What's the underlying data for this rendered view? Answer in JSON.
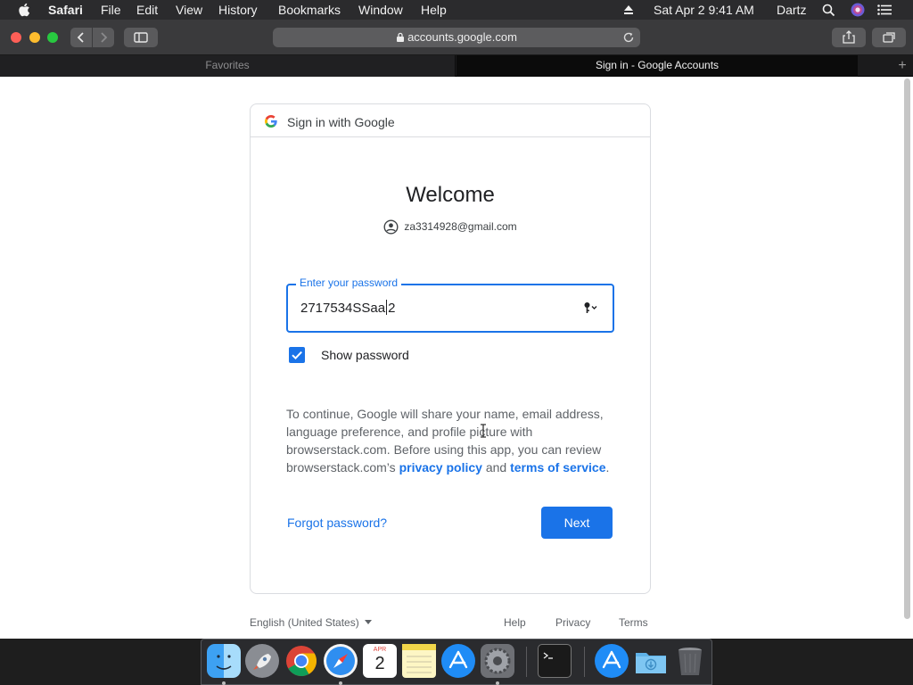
{
  "menubar": {
    "app_name": "Safari",
    "menus": [
      "File",
      "Edit",
      "View",
      "History",
      "Bookmarks",
      "Window",
      "Help"
    ],
    "datetime": "Sat Apr 2  9:41 AM",
    "user": "Dartz",
    "icons": [
      "apple-icon",
      "eject-icon",
      "search-icon",
      "siri-icon",
      "notification-center-icon"
    ]
  },
  "toolbar": {
    "url": "accounts.google.com",
    "icons": [
      "back-icon",
      "forward-icon",
      "sidebar-icon",
      "lock-icon",
      "reload-icon",
      "share-icon",
      "tabs-overview-icon"
    ]
  },
  "tabs": [
    {
      "label": "Favorites",
      "active": false
    },
    {
      "label": "Sign in - Google Accounts",
      "active": true
    }
  ],
  "new_tab_label": "+",
  "signin": {
    "header_title": "Sign in with Google",
    "welcome": "Welcome",
    "email": "za3314928@gmail.com",
    "password_label": "Enter your password",
    "password_before_caret": "2717534SSaa",
    "password_after_caret": "2",
    "show_password_label": "Show password",
    "show_password_checked": true,
    "disclaimer_text": "To continue, Google will share your name, email address, language preference, and profile picture with browserstack.com. Before using this app, you can review browserstack.com’s ",
    "privacy_link": "privacy policy",
    "and_text": " and ",
    "terms_link": "terms of service",
    "period": ".",
    "forgot_label": "Forgot password?",
    "next_label": "Next"
  },
  "footer": {
    "language": "English (United States)",
    "help": "Help",
    "privacy": "Privacy",
    "terms": "Terms"
  },
  "dock": {
    "apps": [
      "Finder",
      "Launchpad",
      "Chrome",
      "Safari",
      "Calendar",
      "Notes",
      "App Store",
      "System Preferences",
      "Terminal",
      "App Store",
      "Downloads",
      "Trash"
    ],
    "calendar_month": "APR",
    "calendar_day": "2"
  },
  "colors": {
    "accent": "#1a73e8",
    "menubar_bg": "#2b2b2d",
    "toolbar_bg": "#3a3a3c",
    "text_primary": "#202124",
    "text_secondary": "#5f6368"
  }
}
